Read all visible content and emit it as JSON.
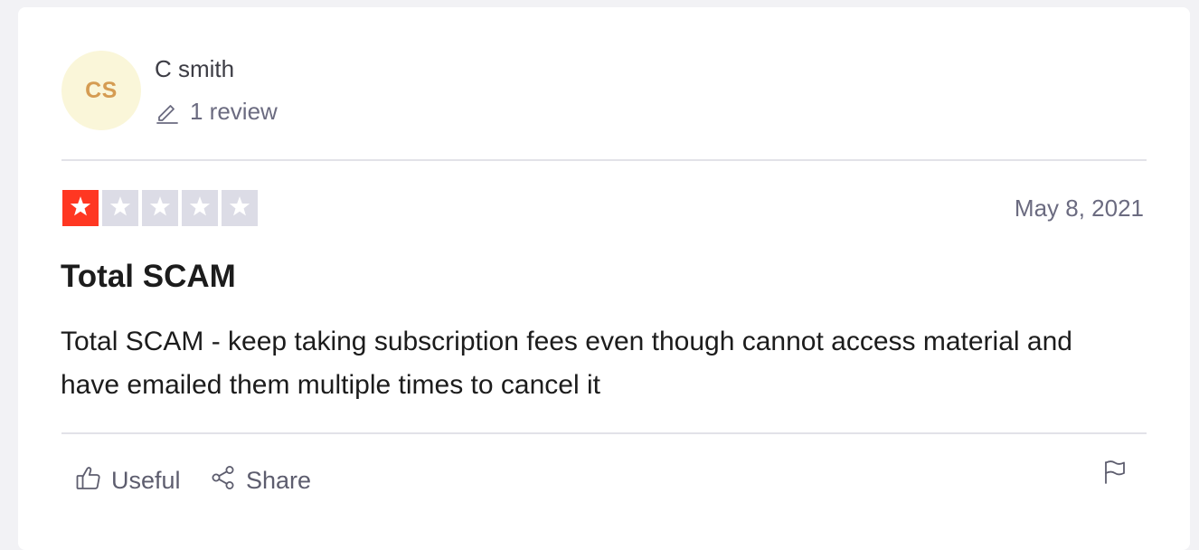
{
  "reviewer": {
    "initials": "CS",
    "name": "C smith",
    "review_count": "1 review",
    "icon": "pencil-icon"
  },
  "review": {
    "rating": 1,
    "rating_max": 5,
    "date": "May 8, 2021",
    "title": "Total SCAM",
    "body": "Total SCAM - keep taking subscription fees even though cannot access material and have emailed them multiple times to cancel it"
  },
  "actions": {
    "useful_label": "Useful",
    "useful_icon": "thumbs-up-icon",
    "share_label": "Share",
    "share_icon": "share-icon",
    "report_icon": "flag-icon"
  },
  "colors": {
    "star_filled": "#ff3722",
    "star_empty": "#dcdce6",
    "avatar_bg": "#faf6d9",
    "avatar_text": "#d59c52"
  }
}
